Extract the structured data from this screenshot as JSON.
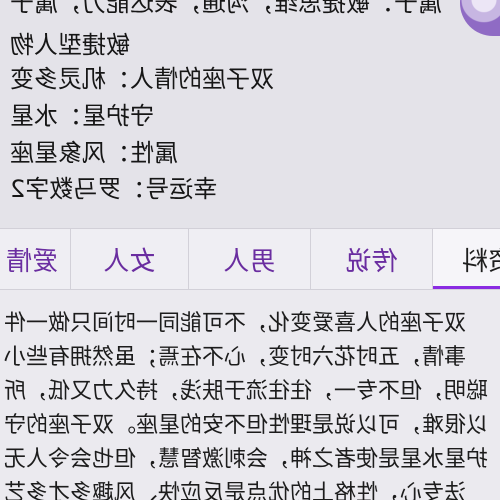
{
  "profile": {
    "lines": [
      "属于：敏捷思维，沟通，表达能力，属于",
      "敏捷型人物",
      "双子座的情人：机灵多变",
      "守护星：水星",
      "属性：风象星座",
      "幸运号：罗马数字2"
    ]
  },
  "tabs": [
    {
      "label": "资料",
      "active": true
    },
    {
      "label": "传说",
      "active": false
    },
    {
      "label": "男人",
      "active": false
    },
    {
      "label": "女人",
      "active": false
    },
    {
      "label": "爱情",
      "active": false
    }
  ],
  "colors": {
    "accent": "#8a2be2",
    "tab_text": "#6a2da0"
  },
  "content": {
    "paragraphs": [
      "双子座的人喜爱变化，不可能同一时间只做一件",
      "事情，五时花六时变，心不在焉；虽然拥有些小",
      "聪明，但不专一，往往流于肤浅，持久力又低，所",
      "以很难，可以说是理性但不安的星座。双子座的守",
      "护星水星是使者之神，会刺激智慧，但也会令人无",
      "法专心，性格上的优点是反应快、风趣多才多艺"
    ]
  }
}
